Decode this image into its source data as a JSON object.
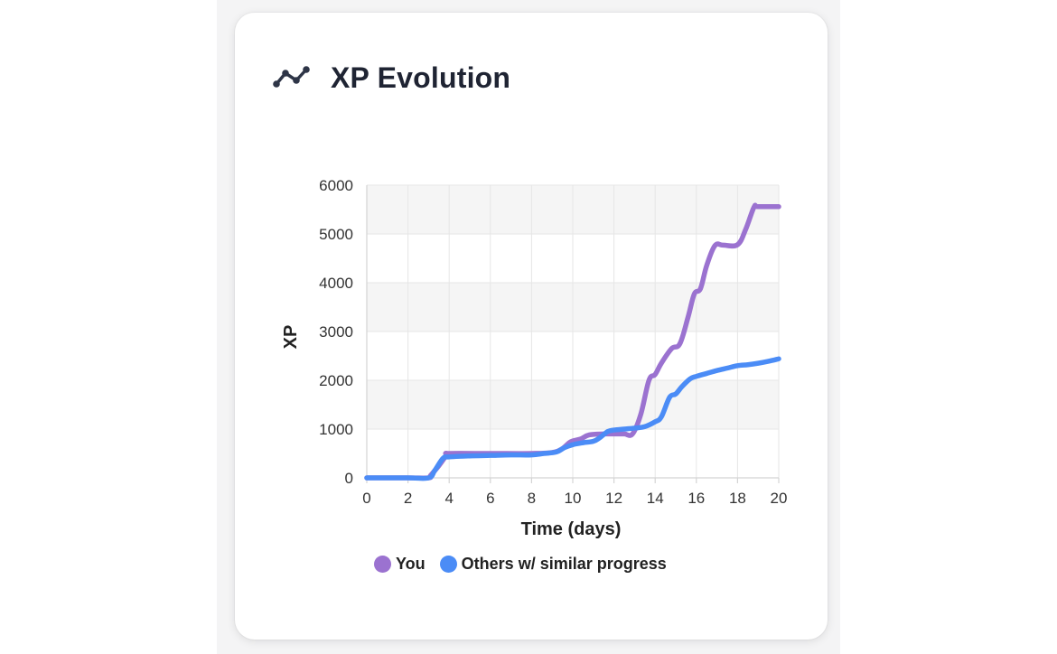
{
  "card": {
    "title": "XP Evolution",
    "icon": "line-chart-icon"
  },
  "colors": {
    "you": "#9b72d0",
    "others": "#4b8cf6",
    "band": "#f5f5f5",
    "grid": "#e6e6e6",
    "title": "#1f2433"
  },
  "chart_data": {
    "type": "line",
    "title": "",
    "xlabel": "Time (days)",
    "ylabel": "XP",
    "xlim": [
      0,
      20
    ],
    "ylim": [
      0,
      6000
    ],
    "x_ticks": [
      "0",
      "2",
      "4",
      "6",
      "8",
      "10",
      "12",
      "14",
      "16",
      "18",
      "20"
    ],
    "y_ticks": [
      "0",
      "1000",
      "2000",
      "3000",
      "4000",
      "5000",
      "6000"
    ],
    "grid": true,
    "legend_position": "bottom",
    "series": [
      {
        "name": "You",
        "color": "#9b72d0",
        "points": [
          [
            0,
            0
          ],
          [
            2,
            0
          ],
          [
            3,
            0
          ],
          [
            3.1,
            50
          ],
          [
            3.5,
            250
          ],
          [
            3.9,
            480
          ],
          [
            4,
            500
          ],
          [
            6,
            500
          ],
          [
            8,
            500
          ],
          [
            9,
            520
          ],
          [
            9.5,
            600
          ],
          [
            9.9,
            740
          ],
          [
            10.4,
            800
          ],
          [
            10.8,
            880
          ],
          [
            11.5,
            900
          ],
          [
            12,
            900
          ],
          [
            12.5,
            900
          ],
          [
            12.9,
            900
          ],
          [
            13.3,
            1300
          ],
          [
            13.7,
            2000
          ],
          [
            14,
            2120
          ],
          [
            14.3,
            2350
          ],
          [
            14.8,
            2650
          ],
          [
            15.2,
            2750
          ],
          [
            15.6,
            3300
          ],
          [
            15.9,
            3770
          ],
          [
            16.2,
            3880
          ],
          [
            16.5,
            4350
          ],
          [
            16.9,
            4760
          ],
          [
            17.3,
            4770
          ],
          [
            18,
            4780
          ],
          [
            18.4,
            5100
          ],
          [
            18.8,
            5550
          ],
          [
            19,
            5560
          ],
          [
            20,
            5560
          ]
        ]
      },
      {
        "name": "Others w/ similar progress",
        "color": "#4b8cf6",
        "points": [
          [
            0,
            0
          ],
          [
            2,
            0
          ],
          [
            3,
            0
          ],
          [
            3.3,
            150
          ],
          [
            3.7,
            400
          ],
          [
            4,
            430
          ],
          [
            5,
            450
          ],
          [
            6,
            460
          ],
          [
            7,
            470
          ],
          [
            8,
            470
          ],
          [
            8.6,
            500
          ],
          [
            9.2,
            530
          ],
          [
            9.6,
            620
          ],
          [
            10,
            680
          ],
          [
            10.5,
            720
          ],
          [
            11,
            750
          ],
          [
            11.3,
            820
          ],
          [
            11.7,
            950
          ],
          [
            12,
            980
          ],
          [
            12.5,
            1000
          ],
          [
            13,
            1020
          ],
          [
            13.5,
            1050
          ],
          [
            14,
            1150
          ],
          [
            14.3,
            1250
          ],
          [
            14.7,
            1650
          ],
          [
            15,
            1720
          ],
          [
            15.3,
            1870
          ],
          [
            15.7,
            2030
          ],
          [
            16,
            2080
          ],
          [
            16.5,
            2140
          ],
          [
            17,
            2200
          ],
          [
            17.5,
            2250
          ],
          [
            18,
            2300
          ],
          [
            18.5,
            2320
          ],
          [
            19,
            2350
          ],
          [
            19.5,
            2390
          ],
          [
            20,
            2440
          ]
        ]
      }
    ]
  }
}
